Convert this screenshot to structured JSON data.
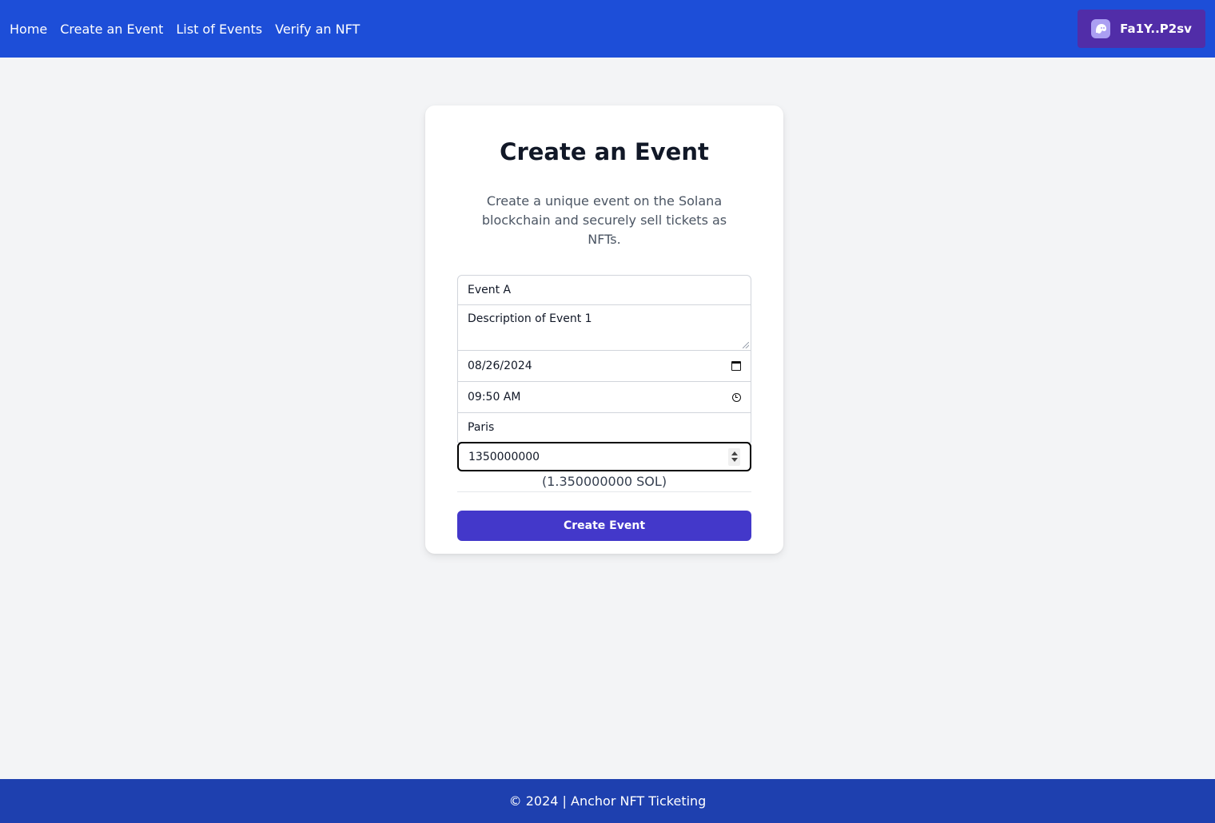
{
  "nav": {
    "links": [
      "Home",
      "Create an Event",
      "List of Events",
      "Verify an NFT"
    ],
    "wallet": {
      "address": "Fa1Y..P2sv",
      "icon": "phantom-ghost-icon"
    }
  },
  "card": {
    "title": "Create an Event",
    "description": "Create a unique event on the Solana blockchain and securely sell tickets as NFTs."
  },
  "form": {
    "name": "Event A",
    "description": "Description of Event 1",
    "date": "08/26/2024",
    "time": "09:50 AM",
    "location": "Paris",
    "price": "1350000000",
    "price_sol": "(1.350000000 SOL)",
    "submit_label": "Create Event"
  },
  "footer": {
    "text": "© 2024 | Anchor NFT Ticketing"
  },
  "colors": {
    "nav_bg": "#1d4ed8",
    "wallet_bg": "#512da8",
    "button_bg": "#4338ca",
    "footer_bg": "#1e40af",
    "page_bg": "#f3f4f6"
  }
}
